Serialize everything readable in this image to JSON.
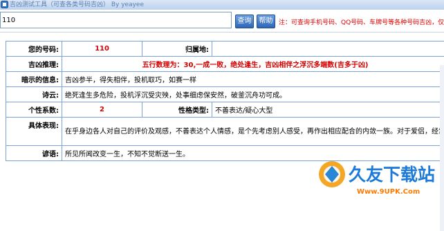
{
  "window": {
    "title": "吉凶测试工具（可查各类号码吉凶） By yeayee"
  },
  "search": {
    "value": "110"
  },
  "buttons": {
    "query": "查询",
    "help": "帮助"
  },
  "hint": "注：可查询手机号码、QQ号码、车牌号等各种号码吉凶，仅供参考",
  "rows": {
    "number": {
      "label": "您的号码:",
      "value": "110"
    },
    "location": {
      "label": "归属地:",
      "value": ""
    },
    "inference": {
      "label": "吉凶推理:",
      "value": "五行数理为：30,一成一败，绝处逢生，吉凶相伴之浮沉多端数(吉多于凶)"
    },
    "hint_info": {
      "label": "暗示的信息:",
      "value": "吉凶参半，得失相伴，投机取巧，如赛一样"
    },
    "poem": {
      "label": "诗云:",
      "value": "绝死逢生多危险，投机浮沉受灾殃，处事细虑保安然，破釜沉舟功可成。"
    },
    "coefficient": {
      "label": "个性系数:",
      "value": "2"
    },
    "personality": {
      "label": "性格类型:",
      "value": "不善表达/疑心大型"
    },
    "performance": {
      "label": "具体表现:",
      "value": "在乎身边各人对自己的评价及观感，不善表达个人情感，是个先考虑别人感受，再作出相应配合的内敛一族。对于爱侣，经常存有怀疑之心。"
    },
    "proverb": {
      "label": "谚语:",
      "value": "所见所闻改变一生，不知不觉断送一生。"
    }
  },
  "watermark": {
    "text": "久友下载站",
    "url": "Www.9UPK.Com"
  },
  "colors": {
    "accent": "#2f66b5",
    "emphasis": "#d40000",
    "border": "#7aa3d6"
  }
}
